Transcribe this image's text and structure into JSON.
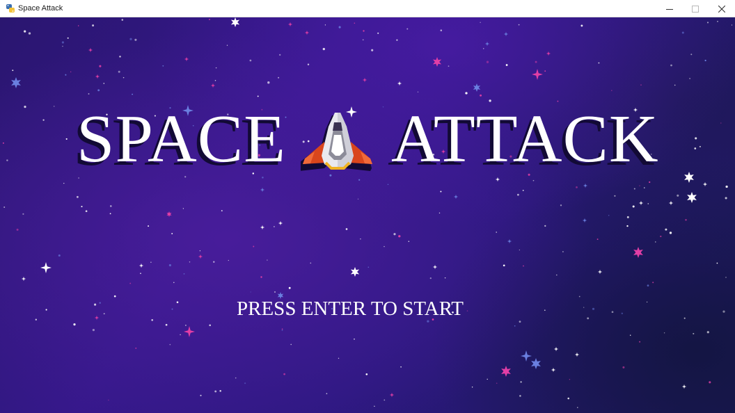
{
  "window": {
    "title": "Space Attack",
    "app_icon": "python-icon",
    "controls": [
      "minimize-icon",
      "maximize-icon",
      "close-icon"
    ]
  },
  "game": {
    "title_left": "SPACE",
    "title_right": "ATTACK",
    "title_ship": "spaceship-icon",
    "prompt": "PRESS ENTER TO START"
  },
  "colors": {
    "background_purple": "#35188a",
    "background_navy": "#1b1a58",
    "text": "#ffffff",
    "text_shadow": "#120a35",
    "star_white": "#ffffff",
    "star_pink": "#e23ea6",
    "star_blue": "#6a7fe0"
  }
}
